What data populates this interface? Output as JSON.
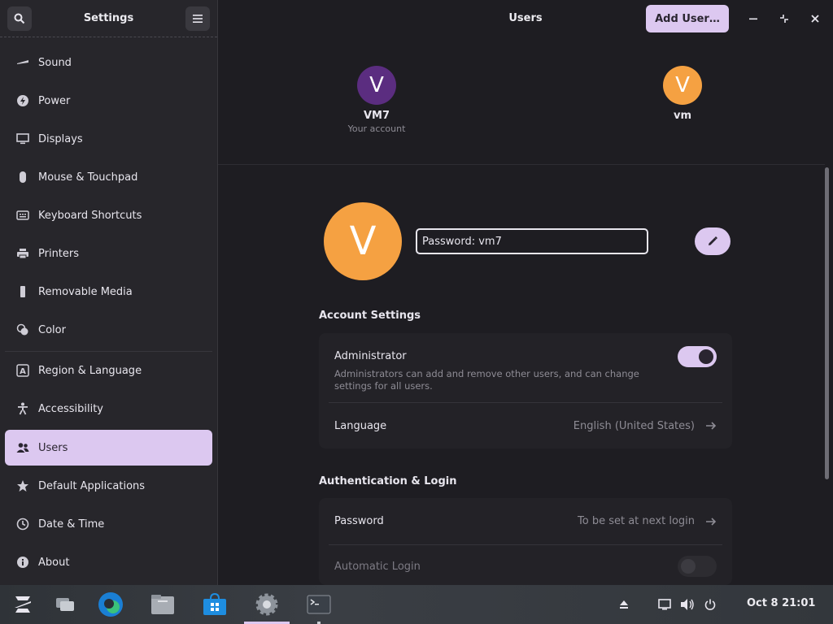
{
  "sidebar": {
    "title": "Settings",
    "items": [
      {
        "label": "Sound",
        "icon": "speaker-icon"
      },
      {
        "label": "Power",
        "icon": "power-bolt-icon"
      },
      {
        "label": "Displays",
        "icon": "monitor-icon"
      },
      {
        "label": "Mouse & Touchpad",
        "icon": "mouse-icon"
      },
      {
        "label": "Keyboard Shortcuts",
        "icon": "keyboard-icon"
      },
      {
        "label": "Printers",
        "icon": "printer-icon"
      },
      {
        "label": "Removable Media",
        "icon": "usb-icon"
      },
      {
        "label": "Color",
        "icon": "color-icon"
      },
      {
        "label": "Region & Language",
        "icon": "region-icon"
      },
      {
        "label": "Accessibility",
        "icon": "accessibility-icon"
      },
      {
        "label": "Users",
        "icon": "users-icon",
        "active": true
      },
      {
        "label": "Default Applications",
        "icon": "star-icon"
      },
      {
        "label": "Date & Time",
        "icon": "clock-icon"
      },
      {
        "label": "About",
        "icon": "info-icon"
      }
    ]
  },
  "header": {
    "title": "Users",
    "add_user_label": "Add User…"
  },
  "users": [
    {
      "initial": "V",
      "name": "VM7",
      "sub": "Your account",
      "color": "#5b2d80"
    },
    {
      "initial": "V",
      "name": "vm",
      "sub": "",
      "color": "#f5a142"
    }
  ],
  "selected_user": {
    "initial": "V",
    "avatar_color": "#f5a142",
    "name_field_value": "Password: vm7"
  },
  "account_settings": {
    "title": "Account Settings",
    "administrator": {
      "label": "Administrator",
      "description": "Administrators can add and remove other users, and can change settings for all users.",
      "enabled": true
    },
    "language": {
      "label": "Language",
      "value": "English (United States)"
    }
  },
  "auth": {
    "title": "Authentication & Login",
    "password": {
      "label": "Password",
      "value": "To be set at next login"
    },
    "automatic_login": {
      "label": "Automatic Login",
      "enabled": false
    }
  },
  "taskbar": {
    "clock": "Oct 8  21:01"
  },
  "colors": {
    "accent": "#dcc8f0",
    "background": "#1e1d22",
    "sidebar": "#27262b"
  }
}
